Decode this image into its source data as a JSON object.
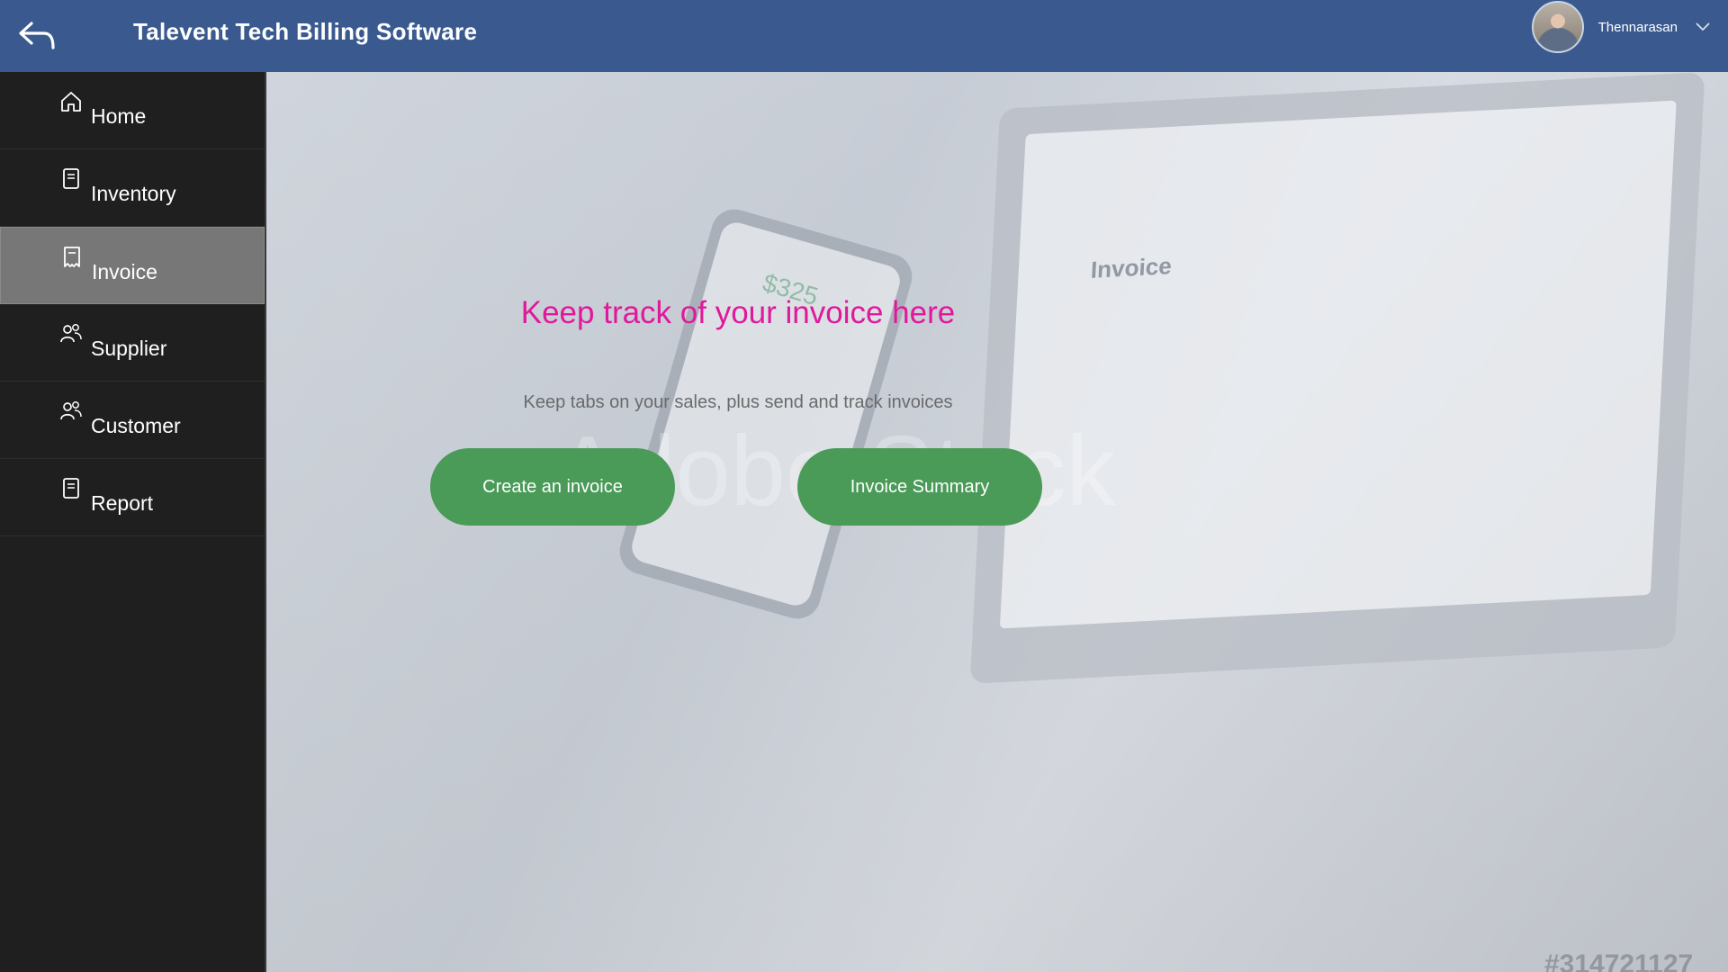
{
  "header": {
    "back_icon": "back-arrow-icon",
    "title": "Talevent Tech Billing Software",
    "user": {
      "name": "Thennarasan",
      "avatar_icon": "user-avatar",
      "menu_icon": "chevron-down-icon"
    },
    "color": "#3a5a8f"
  },
  "sidebar": {
    "items": [
      {
        "label": "Home",
        "icon": "home-icon",
        "active": false
      },
      {
        "label": "Inventory",
        "icon": "document-icon",
        "active": false
      },
      {
        "label": "Invoice",
        "icon": "receipt-icon",
        "active": true
      },
      {
        "label": "Supplier",
        "icon": "people-icon",
        "active": false
      },
      {
        "label": "Customer",
        "icon": "people-icon",
        "active": false
      },
      {
        "label": "Report",
        "icon": "document-icon",
        "active": false
      }
    ],
    "active_color": "#777777"
  },
  "main": {
    "headline": "Keep track of your invoice here",
    "subheadline": "Keep tabs on your sales, plus send and track invoices",
    "buttons": {
      "create": "Create an invoice",
      "summary": "Invoice Summary"
    },
    "headline_color": "#e0199a",
    "button_color": "#4a9a58",
    "background": {
      "document_title": "Invoice",
      "phone_amount": "$325",
      "watermark": "Adobe Stock",
      "stock_id": "#314721127"
    }
  }
}
